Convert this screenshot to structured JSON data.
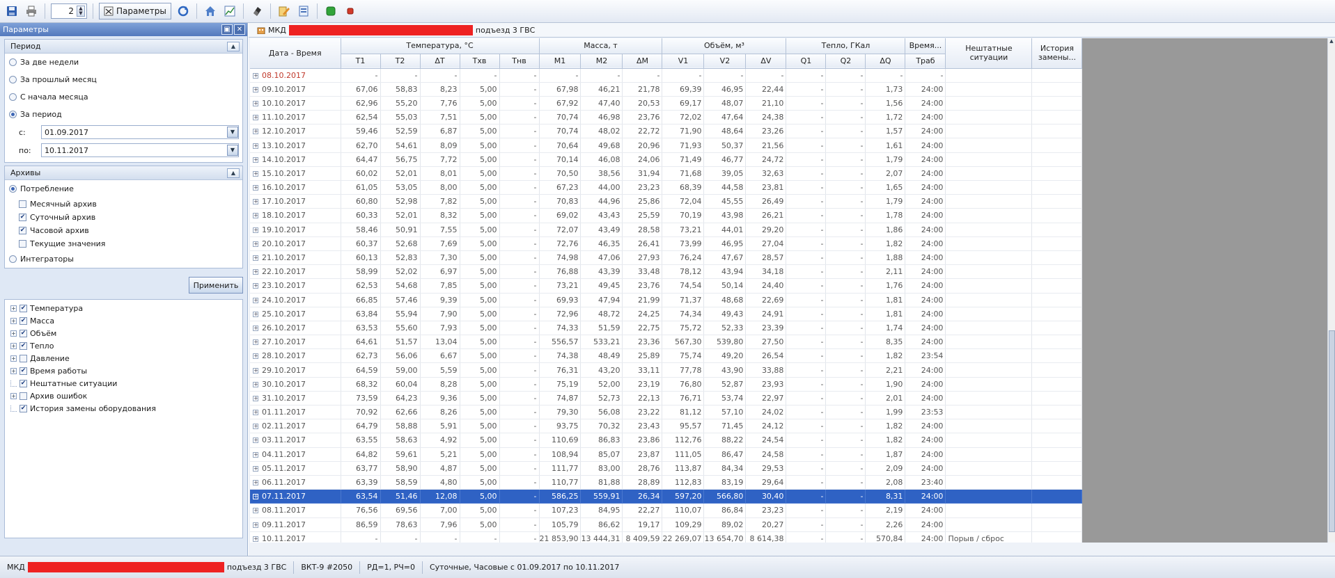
{
  "toolbar": {
    "spin_value": "2",
    "params_label": "Параметры",
    "icons": [
      "save-icon",
      "print-icon",
      "refresh-icon",
      "home-icon",
      "chart-icon",
      "erase-icon",
      "edit-icon",
      "document-icon",
      "play-icon",
      "stop-icon"
    ]
  },
  "left": {
    "title": "Параметры",
    "period": {
      "header": "Период",
      "options": [
        "За две недели",
        "За прошлый месяц",
        "С начала месяца",
        "За период"
      ],
      "selected": "За период",
      "from_label": "с:",
      "from_value": "01.09.2017",
      "to_label": "по:",
      "to_value": "10.11.2017"
    },
    "archives": {
      "header": "Архивы",
      "consumption": "Потребление",
      "checks": [
        "Месячный архив",
        "Суточный архив",
        "Часовой архив",
        "Текущие значения"
      ],
      "checked": [
        "Суточный архив",
        "Часовой архив"
      ],
      "integrators": "Интеграторы"
    },
    "apply": "Применить",
    "tree": [
      "Температура",
      "Масса",
      "Объём",
      "Тепло",
      "Давление",
      "Время работы",
      "Нештатные ситуации",
      "Архив ошибок",
      "История замены оборудования"
    ]
  },
  "object_bar": {
    "prefix": "МКД",
    "suffix": "подъезд 3 ГВС"
  },
  "grid": {
    "group_headers": {
      "datetime": "Дата - Время",
      "temperature": "Температура, °С",
      "mass": "Масса, т",
      "volume": "Объём, м³",
      "heat": "Тепло, ГКал",
      "time": "Время...",
      "emergency": "Нештатные ситуации",
      "history": "История замены..."
    },
    "sub_headers": [
      "T1",
      "T2",
      "ΔT",
      "Tхв",
      "Tнв",
      "M1",
      "M2",
      "ΔM",
      "V1",
      "V2",
      "ΔV",
      "Q1",
      "Q2",
      "ΔQ",
      "Tраб"
    ],
    "rows": [
      {
        "d": "08.10.2017",
        "v": [
          "-",
          "-",
          "-",
          "-",
          "-",
          "-",
          "-",
          "-",
          "-",
          "-",
          "-",
          "-",
          "-",
          "-",
          "-"
        ],
        "note": "",
        "red": true
      },
      {
        "d": "09.10.2017",
        "v": [
          "67,06",
          "58,83",
          "8,23",
          "5,00",
          "-",
          "67,98",
          "46,21",
          "21,78",
          "69,39",
          "46,95",
          "22,44",
          "-",
          "-",
          "1,73",
          "24:00"
        ],
        "note": ""
      },
      {
        "d": "10.10.2017",
        "v": [
          "62,96",
          "55,20",
          "7,76",
          "5,00",
          "-",
          "67,92",
          "47,40",
          "20,53",
          "69,17",
          "48,07",
          "21,10",
          "-",
          "-",
          "1,56",
          "24:00"
        ],
        "note": ""
      },
      {
        "d": "11.10.2017",
        "v": [
          "62,54",
          "55,03",
          "7,51",
          "5,00",
          "-",
          "70,74",
          "46,98",
          "23,76",
          "72,02",
          "47,64",
          "24,38",
          "-",
          "-",
          "1,72",
          "24:00"
        ],
        "note": ""
      },
      {
        "d": "12.10.2017",
        "v": [
          "59,46",
          "52,59",
          "6,87",
          "5,00",
          "-",
          "70,74",
          "48,02",
          "22,72",
          "71,90",
          "48,64",
          "23,26",
          "-",
          "-",
          "1,57",
          "24:00"
        ],
        "note": ""
      },
      {
        "d": "13.10.2017",
        "v": [
          "62,70",
          "54,61",
          "8,09",
          "5,00",
          "-",
          "70,64",
          "49,68",
          "20,96",
          "71,93",
          "50,37",
          "21,56",
          "-",
          "-",
          "1,61",
          "24:00"
        ],
        "note": ""
      },
      {
        "d": "14.10.2017",
        "v": [
          "64,47",
          "56,75",
          "7,72",
          "5,00",
          "-",
          "70,14",
          "46,08",
          "24,06",
          "71,49",
          "46,77",
          "24,72",
          "-",
          "-",
          "1,79",
          "24:00"
        ],
        "note": ""
      },
      {
        "d": "15.10.2017",
        "v": [
          "60,02",
          "52,01",
          "8,01",
          "5,00",
          "-",
          "70,50",
          "38,56",
          "31,94",
          "71,68",
          "39,05",
          "32,63",
          "-",
          "-",
          "2,07",
          "24:00"
        ],
        "note": ""
      },
      {
        "d": "16.10.2017",
        "v": [
          "61,05",
          "53,05",
          "8,00",
          "5,00",
          "-",
          "67,23",
          "44,00",
          "23,23",
          "68,39",
          "44,58",
          "23,81",
          "-",
          "-",
          "1,65",
          "24:00"
        ],
        "note": ""
      },
      {
        "d": "17.10.2017",
        "v": [
          "60,80",
          "52,98",
          "7,82",
          "5,00",
          "-",
          "70,83",
          "44,96",
          "25,86",
          "72,04",
          "45,55",
          "26,49",
          "-",
          "-",
          "1,79",
          "24:00"
        ],
        "note": ""
      },
      {
        "d": "18.10.2017",
        "v": [
          "60,33",
          "52,01",
          "8,32",
          "5,00",
          "-",
          "69,02",
          "43,43",
          "25,59",
          "70,19",
          "43,98",
          "26,21",
          "-",
          "-",
          "1,78",
          "24:00"
        ],
        "note": ""
      },
      {
        "d": "19.10.2017",
        "v": [
          "58,46",
          "50,91",
          "7,55",
          "5,00",
          "-",
          "72,07",
          "43,49",
          "28,58",
          "73,21",
          "44,01",
          "29,20",
          "-",
          "-",
          "1,86",
          "24:00"
        ],
        "note": ""
      },
      {
        "d": "20.10.2017",
        "v": [
          "60,37",
          "52,68",
          "7,69",
          "5,00",
          "-",
          "72,76",
          "46,35",
          "26,41",
          "73,99",
          "46,95",
          "27,04",
          "-",
          "-",
          "1,82",
          "24:00"
        ],
        "note": ""
      },
      {
        "d": "21.10.2017",
        "v": [
          "60,13",
          "52,83",
          "7,30",
          "5,00",
          "-",
          "74,98",
          "47,06",
          "27,93",
          "76,24",
          "47,67",
          "28,57",
          "-",
          "-",
          "1,88",
          "24:00"
        ],
        "note": ""
      },
      {
        "d": "22.10.2017",
        "v": [
          "58,99",
          "52,02",
          "6,97",
          "5,00",
          "-",
          "76,88",
          "43,39",
          "33,48",
          "78,12",
          "43,94",
          "34,18",
          "-",
          "-",
          "2,11",
          "24:00"
        ],
        "note": ""
      },
      {
        "d": "23.10.2017",
        "v": [
          "62,53",
          "54,68",
          "7,85",
          "5,00",
          "-",
          "73,21",
          "49,45",
          "23,76",
          "74,54",
          "50,14",
          "24,40",
          "-",
          "-",
          "1,76",
          "24:00"
        ],
        "note": ""
      },
      {
        "d": "24.10.2017",
        "v": [
          "66,85",
          "57,46",
          "9,39",
          "5,00",
          "-",
          "69,93",
          "47,94",
          "21,99",
          "71,37",
          "48,68",
          "22,69",
          "-",
          "-",
          "1,81",
          "24:00"
        ],
        "note": ""
      },
      {
        "d": "25.10.2017",
        "v": [
          "63,84",
          "55,94",
          "7,90",
          "5,00",
          "-",
          "72,96",
          "48,72",
          "24,25",
          "74,34",
          "49,43",
          "24,91",
          "-",
          "-",
          "1,81",
          "24:00"
        ],
        "note": ""
      },
      {
        "d": "26.10.2017",
        "v": [
          "63,53",
          "55,60",
          "7,93",
          "5,00",
          "-",
          "74,33",
          "51,59",
          "22,75",
          "75,72",
          "52,33",
          "23,39",
          "-",
          "-",
          "1,74",
          "24:00"
        ],
        "note": ""
      },
      {
        "d": "27.10.2017",
        "v": [
          "64,61",
          "51,57",
          "13,04",
          "5,00",
          "-",
          "556,57",
          "533,21",
          "23,36",
          "567,30",
          "539,80",
          "27,50",
          "-",
          "-",
          "8,35",
          "24:00"
        ],
        "note": ""
      },
      {
        "d": "28.10.2017",
        "v": [
          "62,73",
          "56,06",
          "6,67",
          "5,00",
          "-",
          "74,38",
          "48,49",
          "25,89",
          "75,74",
          "49,20",
          "26,54",
          "-",
          "-",
          "1,82",
          "23:54"
        ],
        "note": ""
      },
      {
        "d": "29.10.2017",
        "v": [
          "64,59",
          "59,00",
          "5,59",
          "5,00",
          "-",
          "76,31",
          "43,20",
          "33,11",
          "77,78",
          "43,90",
          "33,88",
          "-",
          "-",
          "2,21",
          "24:00"
        ],
        "note": ""
      },
      {
        "d": "30.10.2017",
        "v": [
          "68,32",
          "60,04",
          "8,28",
          "5,00",
          "-",
          "75,19",
          "52,00",
          "23,19",
          "76,80",
          "52,87",
          "23,93",
          "-",
          "-",
          "1,90",
          "24:00"
        ],
        "note": ""
      },
      {
        "d": "31.10.2017",
        "v": [
          "73,59",
          "64,23",
          "9,36",
          "5,00",
          "-",
          "74,87",
          "52,73",
          "22,13",
          "76,71",
          "53,74",
          "22,97",
          "-",
          "-",
          "2,01",
          "24:00"
        ],
        "note": ""
      },
      {
        "d": "01.11.2017",
        "v": [
          "70,92",
          "62,66",
          "8,26",
          "5,00",
          "-",
          "79,30",
          "56,08",
          "23,22",
          "81,12",
          "57,10",
          "24,02",
          "-",
          "-",
          "1,99",
          "23:53"
        ],
        "note": ""
      },
      {
        "d": "02.11.2017",
        "v": [
          "64,79",
          "58,88",
          "5,91",
          "5,00",
          "-",
          "93,75",
          "70,32",
          "23,43",
          "95,57",
          "71,45",
          "24,12",
          "-",
          "-",
          "1,82",
          "24:00"
        ],
        "note": ""
      },
      {
        "d": "03.11.2017",
        "v": [
          "63,55",
          "58,63",
          "4,92",
          "5,00",
          "-",
          "110,69",
          "86,83",
          "23,86",
          "112,76",
          "88,22",
          "24,54",
          "-",
          "-",
          "1,82",
          "24:00"
        ],
        "note": ""
      },
      {
        "d": "04.11.2017",
        "v": [
          "64,82",
          "59,61",
          "5,21",
          "5,00",
          "-",
          "108,94",
          "85,07",
          "23,87",
          "111,05",
          "86,47",
          "24,58",
          "-",
          "-",
          "1,87",
          "24:00"
        ],
        "note": ""
      },
      {
        "d": "05.11.2017",
        "v": [
          "63,77",
          "58,90",
          "4,87",
          "5,00",
          "-",
          "111,77",
          "83,00",
          "28,76",
          "113,87",
          "84,34",
          "29,53",
          "-",
          "-",
          "2,09",
          "24:00"
        ],
        "note": ""
      },
      {
        "d": "06.11.2017",
        "v": [
          "63,39",
          "58,59",
          "4,80",
          "5,00",
          "-",
          "110,77",
          "81,88",
          "28,89",
          "112,83",
          "83,19",
          "29,64",
          "-",
          "-",
          "2,08",
          "23:40"
        ],
        "note": ""
      },
      {
        "d": "07.11.2017",
        "v": [
          "63,54",
          "51,46",
          "12,08",
          "5,00",
          "-",
          "586,25",
          "559,91",
          "26,34",
          "597,20",
          "566,80",
          "30,40",
          "-",
          "-",
          "8,31",
          "24:00"
        ],
        "note": "",
        "sel": true
      },
      {
        "d": "08.11.2017",
        "v": [
          "76,56",
          "69,56",
          "7,00",
          "5,00",
          "-",
          "107,23",
          "84,95",
          "22,27",
          "110,07",
          "86,84",
          "23,23",
          "-",
          "-",
          "2,19",
          "24:00"
        ],
        "note": ""
      },
      {
        "d": "09.11.2017",
        "v": [
          "86,59",
          "78,63",
          "7,96",
          "5,00",
          "-",
          "105,79",
          "86,62",
          "19,17",
          "109,29",
          "89,02",
          "20,27",
          "-",
          "-",
          "2,26",
          "24:00"
        ],
        "note": ""
      },
      {
        "d": "10.11.2017",
        "v": [
          "-",
          "-",
          "-",
          "-",
          "-",
          "21 853,90",
          "13 444,31",
          "8 409,59",
          "22 269,07",
          "13 654,70",
          "8 614,38",
          "-",
          "-",
          "570,84",
          "24:00"
        ],
        "note": "Порыв / сброс"
      }
    ]
  },
  "status": {
    "prefix": "МКД",
    "suffix": "подъезд 3 ГВС",
    "device": "ВКТ-9 #2050",
    "mode": "РД=1, РЧ=0",
    "range": "Суточные, Часовые с 01.09.2017 по 10.11.2017"
  }
}
